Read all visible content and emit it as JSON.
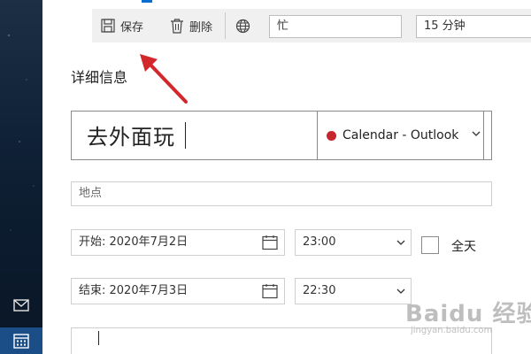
{
  "toolbar": {
    "save_label": "保存",
    "delete_label": "删除",
    "status_value": "忙",
    "reminder_value": "15 分钟"
  },
  "details": {
    "section_title": "详细信息",
    "event_title": "去外面玩",
    "calendar_name": "Calendar - Outlook",
    "calendar_color": "#c8262e",
    "location_placeholder": "地点",
    "start_date": "开始:  2020年7月2日",
    "start_time": "23:00",
    "end_date": "结束:  2020年7月3日",
    "end_time": "22:30",
    "all_day_label": "全天",
    "all_day_checked": false
  },
  "rail": {
    "mail_icon": "mail-icon",
    "calendar_icon": "calendar-icon"
  },
  "watermark": {
    "text": "Baidu 经验",
    "sub": "jingyan.baidu.com"
  },
  "colors": {
    "accent": "#0a6ed1",
    "annotation_arrow": "#d3282b"
  }
}
